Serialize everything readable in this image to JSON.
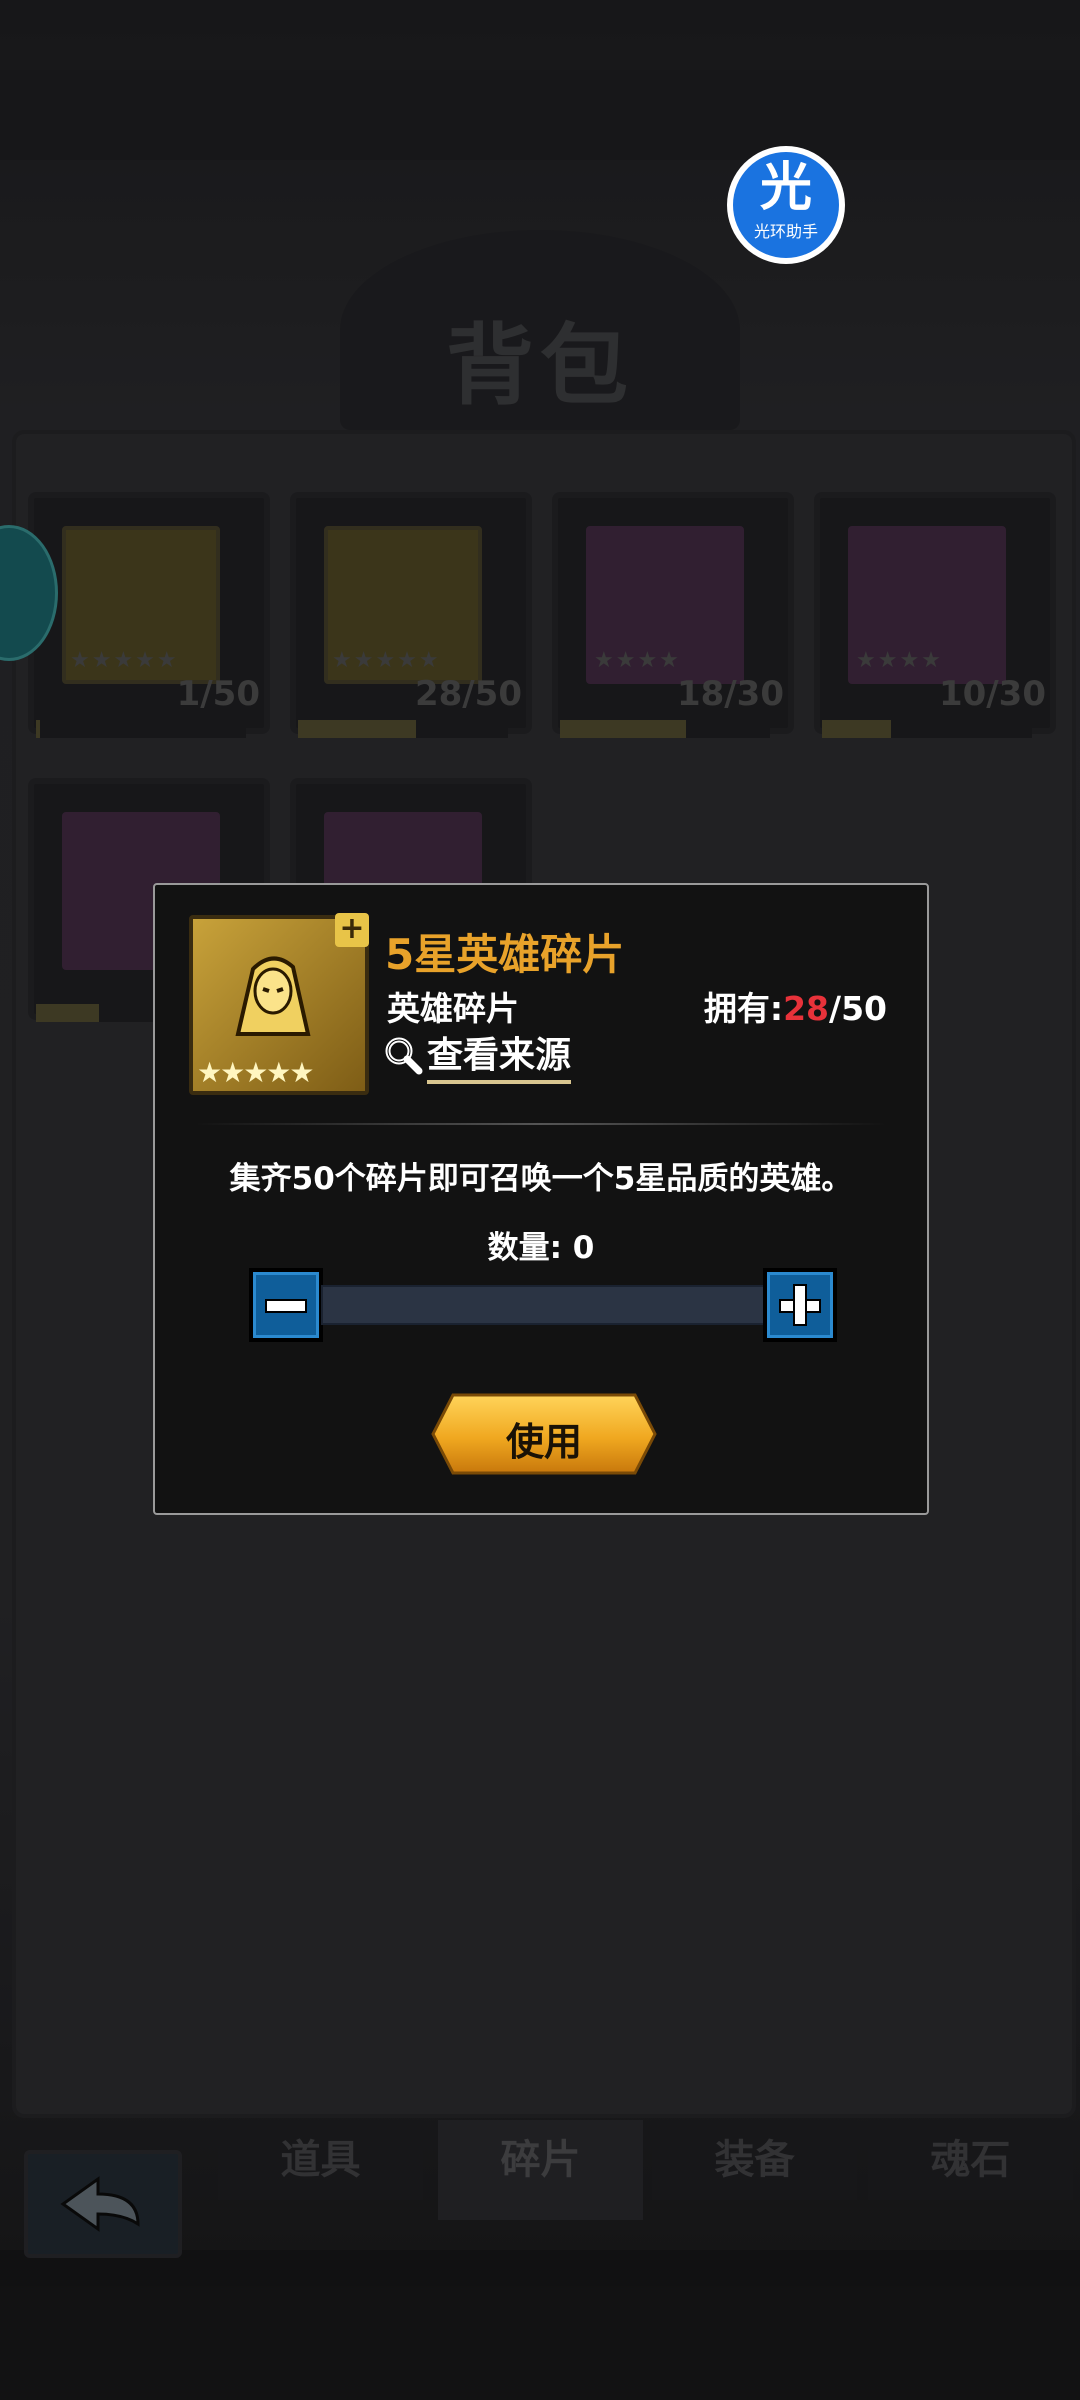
{
  "background": {
    "page_title": "背包",
    "slots": [
      {
        "count": "1/50",
        "progress": 0.02
      },
      {
        "count": "28/50",
        "progress": 0.56
      },
      {
        "count": "18/30",
        "progress": 0.6
      },
      {
        "count": "10/30",
        "progress": 0.33
      },
      {
        "count": "",
        "progress": 0.3
      },
      {
        "count": "",
        "progress": 0.0
      }
    ],
    "tabs": [
      "道具",
      "碎片",
      "装备",
      "魂石"
    ],
    "active_tab": "碎片"
  },
  "floating_assistant": {
    "glyph": "光",
    "label": "光环助手"
  },
  "dialog": {
    "item_name": "5星英雄碎片",
    "item_type": "英雄碎片",
    "owned_label": "拥有:",
    "owned_current": "28",
    "owned_total": "/50",
    "source_link": "查看来源",
    "description": "集齐50个碎片即可召唤一个5星品质的英雄。",
    "quantity_label": "数量:  0",
    "quantity_value": 0,
    "use_button": "使用",
    "stars": "★★★★★",
    "rarity_stars": 5
  },
  "colors": {
    "accent_gold": "#e8a22a",
    "owned_red": "#e8323a",
    "stepper_blue": "#0f5e9a"
  }
}
